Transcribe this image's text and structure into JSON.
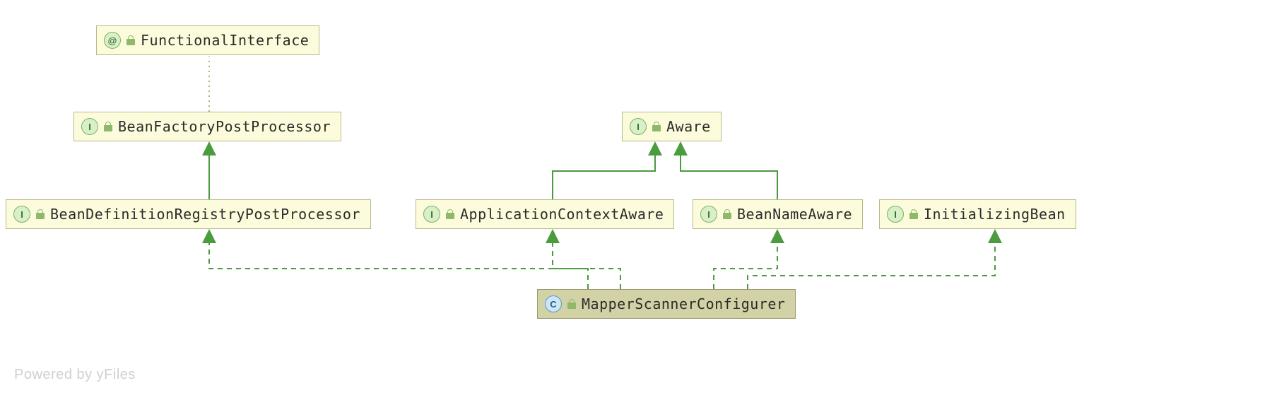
{
  "nodes": {
    "functionalInterface": {
      "label": "FunctionalInterface",
      "type": "annotation"
    },
    "beanFactoryPostProcessor": {
      "label": "BeanFactoryPostProcessor",
      "type": "interface"
    },
    "beanDefinitionRegistryPostProcessor": {
      "label": "BeanDefinitionRegistryPostProcessor",
      "type": "interface"
    },
    "aware": {
      "label": "Aware",
      "type": "interface"
    },
    "applicationContextAware": {
      "label": "ApplicationContextAware",
      "type": "interface"
    },
    "beanNameAware": {
      "label": "BeanNameAware",
      "type": "interface"
    },
    "initializingBean": {
      "label": "InitializingBean",
      "type": "interface"
    },
    "mapperScannerConfigurer": {
      "label": "MapperScannerConfigurer",
      "type": "class"
    }
  },
  "iconGlyphs": {
    "interface": "I",
    "annotation": "@",
    "class": "C"
  },
  "footer": "Powered by yFiles",
  "edges": [
    {
      "from": "beanFactoryPostProcessor",
      "to": "functionalInterface",
      "style": "dotted"
    },
    {
      "from": "beanDefinitionRegistryPostProcessor",
      "to": "beanFactoryPostProcessor",
      "style": "solid"
    },
    {
      "from": "applicationContextAware",
      "to": "aware",
      "style": "solid"
    },
    {
      "from": "beanNameAware",
      "to": "aware",
      "style": "solid"
    },
    {
      "from": "mapperScannerConfigurer",
      "to": "beanDefinitionRegistryPostProcessor",
      "style": "dashed"
    },
    {
      "from": "mapperScannerConfigurer",
      "to": "applicationContextAware",
      "style": "dashed"
    },
    {
      "from": "mapperScannerConfigurer",
      "to": "beanNameAware",
      "style": "dashed"
    },
    {
      "from": "mapperScannerConfigurer",
      "to": "initializingBean",
      "style": "dashed"
    }
  ]
}
